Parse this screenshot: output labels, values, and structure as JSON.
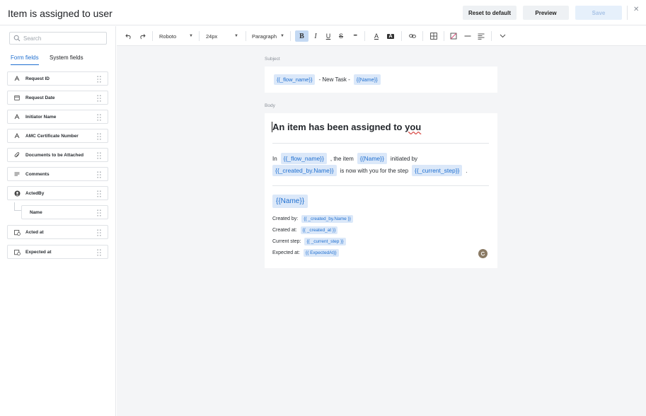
{
  "header": {
    "title": "Item is assigned to user",
    "reset_label": "Reset to default",
    "preview_label": "Preview",
    "save_label": "Save",
    "close_icon": "close-icon"
  },
  "sidebar": {
    "search_placeholder": "Search",
    "tabs": [
      {
        "label": "Form fields",
        "active": true
      },
      {
        "label": "System fields",
        "active": false
      }
    ],
    "fields": [
      {
        "label": "Request ID",
        "icon": "text-icon"
      },
      {
        "label": "Request Date",
        "icon": "calendar-icon"
      },
      {
        "label": "Initiator Name",
        "icon": "text-icon"
      },
      {
        "label": "AMC Certificate Number",
        "icon": "text-icon"
      },
      {
        "label": "Documents to be Attached",
        "icon": "attachment-icon"
      },
      {
        "label": "Comments",
        "icon": "lines-icon"
      },
      {
        "label": "ActedBy",
        "icon": "user-icon"
      },
      {
        "label": "Name",
        "icon": ""
      },
      {
        "label": "Acted at",
        "icon": "calendar-clock-icon"
      },
      {
        "label": "Expected at",
        "icon": "calendar-clock-icon"
      }
    ]
  },
  "toolbar": {
    "font_family": "Roboto",
    "font_size": "24px",
    "block_type": "Paragraph",
    "bold": "B",
    "italic": "I",
    "underline": "U",
    "strike": "S",
    "more": "•••",
    "text_color": "A",
    "highlight": "A"
  },
  "editor": {
    "subject_label": "Subject",
    "subject": {
      "chip1": "{{_flow_name}}",
      "text": "- New Task -",
      "chip2": "{{Name}}"
    },
    "body_label": "Body",
    "heading_pre": "An item has been assigned to ",
    "heading_wavy": "you",
    "para": {
      "t1": "In",
      "c1": "{{_flow_name}}",
      "t2": ", the item",
      "c2": "{{Name}}",
      "t3": "initiated by",
      "c3": "{{_created_by.Name}}",
      "t4": "is now with you for the step",
      "c4": "{{_current_step}}",
      "t5": "."
    },
    "name_chip": "{{Name}}",
    "meta": [
      {
        "label": "Created by:",
        "value": "{{ _created_by.Name }}"
      },
      {
        "label": "Created at:",
        "value": "{{ _created_at }}"
      },
      {
        "label": "Current step:",
        "value": "{{ _current_step }}"
      },
      {
        "label": "Expected at:",
        "value": "{{ ExpectedAt}}"
      }
    ]
  },
  "colors": {
    "accent": "#1f6fd0",
    "chip_bg": "#dbe8f9",
    "canvas_bg": "#f4f5f7"
  }
}
